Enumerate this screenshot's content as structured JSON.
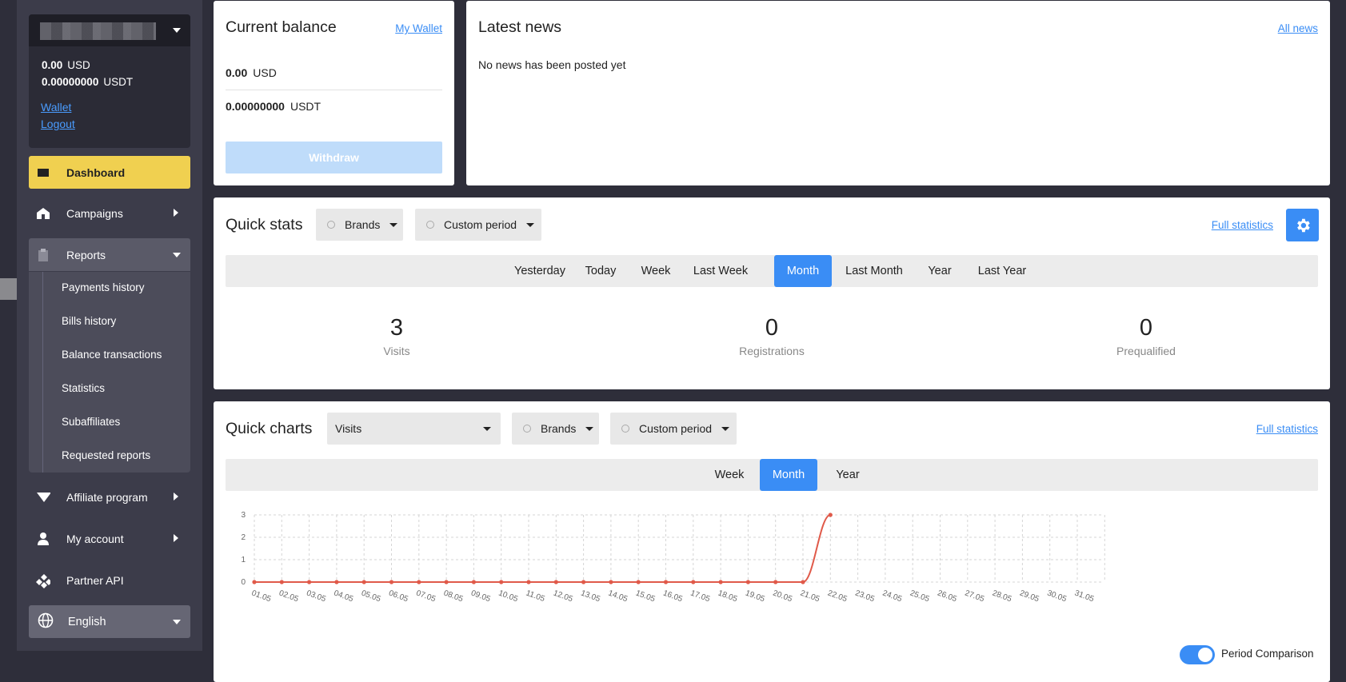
{
  "account": {
    "balances": [
      {
        "amount": "0.00",
        "currency": "USD"
      },
      {
        "amount": "0.00000000",
        "currency": "USDT"
      }
    ],
    "links": [
      "Wallet",
      "Logout"
    ]
  },
  "nav": {
    "dashboard": "Dashboard",
    "campaigns": "Campaigns",
    "reports": "Reports",
    "report_items": [
      "Payments history",
      "Bills history",
      "Balance transactions",
      "Statistics",
      "Subaffiliates",
      "Requested reports"
    ],
    "affiliate": "Affiliate program",
    "my_account": "My account",
    "partner_api": "Partner API",
    "language": "English"
  },
  "balance_card": {
    "title": "Current balance",
    "link": "My Wallet",
    "rows": [
      {
        "amount": "0.00",
        "currency": "USD"
      },
      {
        "amount": "0.00000000",
        "currency": "USDT"
      }
    ],
    "withdraw": "Withdraw"
  },
  "news_card": {
    "title": "Latest news",
    "link": "All news",
    "empty": "No news has been posted yet"
  },
  "quick_stats": {
    "title": "Quick stats",
    "brands": "Brands",
    "period": "Custom period",
    "link": "Full statistics",
    "tabs": [
      "Yesterday",
      "Today",
      "Week",
      "Last Week",
      "Month",
      "Last Month",
      "Year",
      "Last Year"
    ],
    "active_tab": "Month",
    "stats": [
      {
        "value": "3",
        "label": "Visits"
      },
      {
        "value": "0",
        "label": "Registrations"
      },
      {
        "value": "0",
        "label": "Prequalified"
      }
    ]
  },
  "quick_charts": {
    "title": "Quick charts",
    "metric": "Visits",
    "brands": "Brands",
    "period": "Custom period",
    "link": "Full statistics",
    "tabs": [
      "Week",
      "Month",
      "Year"
    ],
    "active_tab": "Month",
    "period_comparison": "Period Comparison",
    "period_comparison_on": true
  },
  "chart_data": {
    "type": "line",
    "x": [
      "01.05",
      "02.05",
      "03.05",
      "04.05",
      "05.05",
      "06.05",
      "07.05",
      "08.05",
      "09.05",
      "10.05",
      "11.05",
      "12.05",
      "13.05",
      "14.05",
      "15.05",
      "16.05",
      "17.05",
      "18.05",
      "19.05",
      "20.05",
      "21.05",
      "22.05",
      "23.05",
      "24.05",
      "25.05",
      "26.05",
      "27.05",
      "28.05",
      "29.05",
      "30.05",
      "31.05"
    ],
    "series": [
      {
        "values": [
          0,
          0,
          0,
          0,
          0,
          0,
          0,
          0,
          0,
          0,
          0,
          0,
          0,
          0,
          0,
          0,
          0,
          0,
          0,
          0,
          0,
          3,
          null,
          null,
          null,
          null,
          null,
          null,
          null,
          null,
          null
        ]
      }
    ],
    "yticks": [
      "0",
      "1",
      "2",
      "3"
    ],
    "ylim": [
      0,
      3
    ],
    "grid": true,
    "color": "#e05a4a"
  }
}
